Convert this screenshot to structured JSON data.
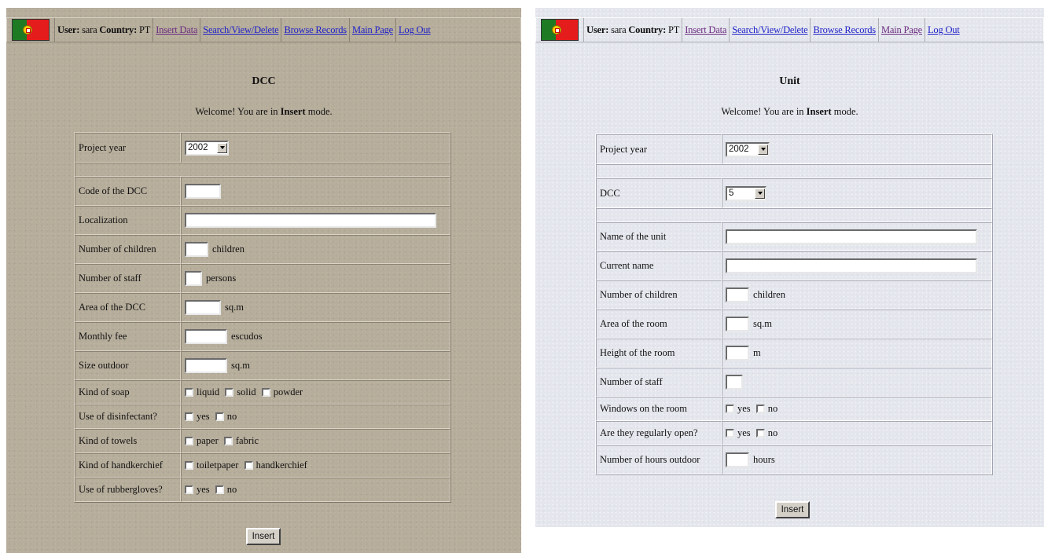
{
  "left": {
    "nav": {
      "user_label": "User:",
      "user_name": "sara",
      "country_label": "Country:",
      "country_code": "PT",
      "links": [
        "Insert Data",
        "Search/View/Delete",
        "Browse Records",
        "Main Page",
        "Log Out"
      ]
    },
    "title": "DCC",
    "welcome_pre": "Welcome! You are in ",
    "welcome_mode": "Insert",
    "welcome_post": " mode.",
    "project_year_label": "Project year",
    "project_year_value": "2002",
    "fields": [
      {
        "label": "Code of the DCC",
        "value": "",
        "unit": ""
      },
      {
        "label": "Localization",
        "value": "",
        "unit": ""
      },
      {
        "label": "Number of children",
        "value": "",
        "unit": "children"
      },
      {
        "label": "Number of staff",
        "value": "",
        "unit": "persons"
      },
      {
        "label": "Area of the DCC",
        "value": "",
        "unit": "sq.m"
      },
      {
        "label": "Monthly fee",
        "value": "",
        "unit": "escudos"
      },
      {
        "label": "Size outdoor",
        "value": "",
        "unit": "sq.m"
      }
    ],
    "checks": [
      {
        "label": "Kind of soap",
        "options": [
          "liquid",
          "solid",
          "powder"
        ]
      },
      {
        "label": "Use of disinfectant?",
        "options": [
          "yes",
          "no"
        ]
      },
      {
        "label": "Kind of towels",
        "options": [
          "paper",
          "fabric"
        ]
      },
      {
        "label": "Kind of handkerchief",
        "options": [
          "toiletpaper",
          "handkerchief"
        ]
      },
      {
        "label": "Use of rubbergloves?",
        "options": [
          "yes",
          "no"
        ]
      }
    ],
    "submit_label": "Insert"
  },
  "right": {
    "nav": {
      "user_label": "User:",
      "user_name": "sara",
      "country_label": "Country:",
      "country_code": "PT",
      "links": [
        "Insert Data",
        "Search/View/Delete",
        "Browse Records",
        "Main Page",
        "Log Out"
      ]
    },
    "title": "Unit",
    "welcome_pre": "Welcome! You are in ",
    "welcome_mode": "Insert",
    "welcome_post": " mode.",
    "project_year_label": "Project year",
    "project_year_value": "2002",
    "dcc_label": "DCC",
    "dcc_value": "5",
    "fields": [
      {
        "label": "Name of the unit",
        "value": "",
        "unit": ""
      },
      {
        "label": "Current name",
        "value": "",
        "unit": ""
      },
      {
        "label": "Number of children",
        "value": "",
        "unit": "children"
      },
      {
        "label": "Area of the room",
        "value": "",
        "unit": "sq.m"
      },
      {
        "label": "Height of the room",
        "value": "",
        "unit": "m"
      },
      {
        "label": "Number of staff",
        "value": "",
        "unit": ""
      }
    ],
    "checks": [
      {
        "label": "Windows on the room",
        "options": [
          "yes",
          "no"
        ]
      },
      {
        "label": "Are they regularly open?",
        "options": [
          "yes",
          "no"
        ]
      }
    ],
    "hours_label": "Number of hours outdoor",
    "hours_unit": "hours",
    "submit_label": "Insert"
  }
}
